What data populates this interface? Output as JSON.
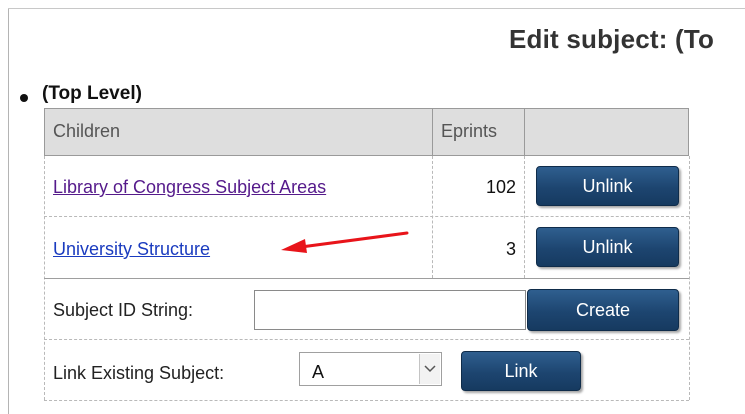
{
  "page": {
    "title": "Edit subject: (To",
    "top_level_label": "(Top Level)"
  },
  "table": {
    "headers": [
      "Children",
      "Eprints",
      ""
    ],
    "rows": [
      {
        "name": "Library of Congress Subject Areas",
        "eprints": "102",
        "action": "Unlink"
      },
      {
        "name": "University Structure",
        "eprints": "3",
        "action": "Unlink"
      }
    ]
  },
  "create_form": {
    "label": "Subject ID String:",
    "value": "",
    "button": "Create"
  },
  "link_form": {
    "label": "Link Existing Subject:",
    "selected": "A",
    "button": "Link"
  },
  "colors": {
    "button_bg": "#1d4570",
    "header_bg": "#dedede",
    "link_visited": "#551a8b",
    "link": "#1a3bbf",
    "annotation_arrow": "#e8141a"
  },
  "icons": {
    "bullet": "bullet-icon",
    "dropdown": "chevron-down-icon",
    "annotation": "red-arrow-icon"
  }
}
